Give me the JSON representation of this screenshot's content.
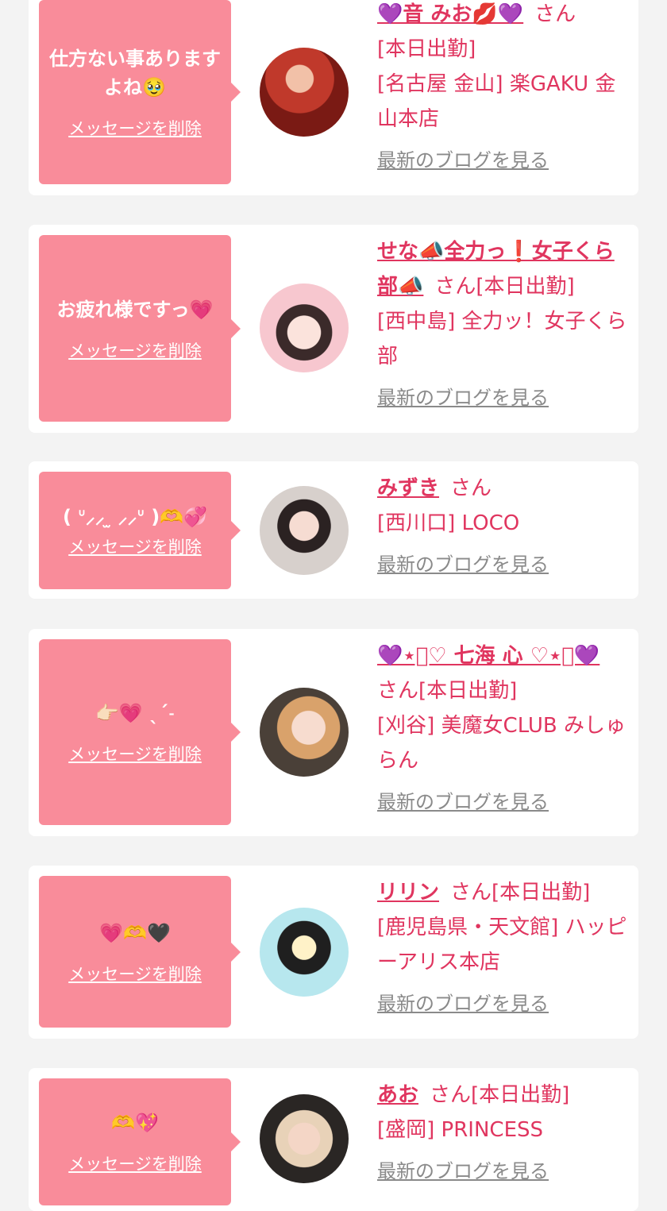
{
  "colors": {
    "accent": "#e0355f",
    "bubble": "#f98c9a",
    "muted": "#8a8a8a",
    "background": "#f3f3f3"
  },
  "delete_label": "メッセージを削除",
  "blog_label": "最新のブログを見る",
  "messages": [
    {
      "message": "仕方ない事ありますよね🥹",
      "name": "💜音 みお💋💜",
      "honorific": "さん",
      "status": "[本日出勤]",
      "shop": "[名古屋 金山] 楽GAKU 金山本店"
    },
    {
      "message": "お疲れ様ですっ💗",
      "name": "せな📣全力っ❗️女子くら部📣",
      "honorific": "さん",
      "status": "[本日出勤]",
      "shop": "[西中島] 全力ッ！女子くら部"
    },
    {
      "message": "( ᐡ⸝⸝ ̫ ⸝⸝ᐡ )🫶💞",
      "name": "みずき",
      "honorific": "さん",
      "status": "",
      "shop": "[西川口] LOCO"
    },
    {
      "message": "👉🏻💗 ˎˊ˗",
      "name": "💜⋆͛♡ 七海 心 ♡⋆͛💜",
      "honorific": "さん",
      "status": "[本日出勤]",
      "shop": "[刈谷] 美魔女CLUB みしゅらん"
    },
    {
      "message": "💗🫶🖤",
      "name": "リリン",
      "honorific": "さん",
      "status": "[本日出勤]",
      "shop": "[鹿児島県・天文館] ハッピーアリス本店"
    },
    {
      "message": "🫶💖",
      "name": "あお",
      "honorific": "さん",
      "status": "[本日出勤]",
      "shop": "[盛岡] PRINCESS"
    }
  ]
}
